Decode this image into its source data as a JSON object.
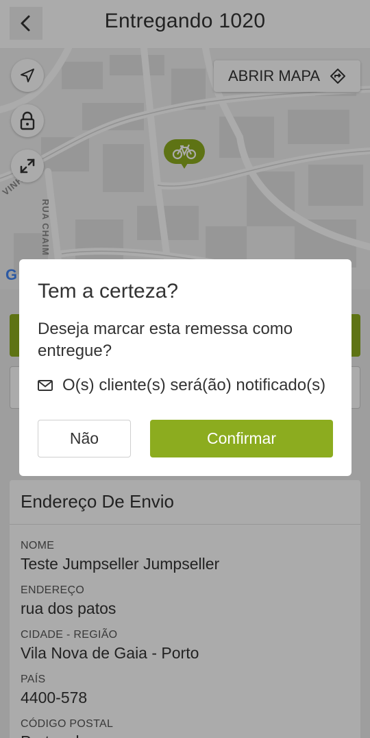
{
  "header": {
    "title": "Entregando 1020",
    "back_icon": "chevron-left-icon"
  },
  "map": {
    "open_map_label": "ABRIR MAPA",
    "open_map_icon": "directions-icon",
    "controls": [
      "navigation-arrow-icon",
      "lock-icon",
      "expand-icon"
    ],
    "marker_icon": "bicycle-icon",
    "street_labels": [
      "RUA CHAIM",
      "VINHA"
    ],
    "attribution": "G",
    "marker_color": "#8cac1f"
  },
  "dialog": {
    "title": "Tem a certeza?",
    "message": "Deseja marcar esta remessa como entregue?",
    "notify_text": "O(s) cliente(s) será(ão) notificado(s)",
    "notify_icon": "envelope-icon",
    "no_label": "Não",
    "confirm_label": "Confirmar",
    "accent_color": "#8cac1f"
  },
  "shipping": {
    "title": "Endereço De Envio",
    "fields": [
      {
        "label": "NOME",
        "value": "Teste Jumpseller Jumpseller"
      },
      {
        "label": "ENDEREÇO",
        "value": "rua dos patos"
      },
      {
        "label": "CIDADE - REGIÃO",
        "value": "Vila Nova de Gaia - Porto"
      },
      {
        "label": "PAÍS",
        "value": "4400-578"
      },
      {
        "label": "CÓDIGO POSTAL",
        "value": "Portugal"
      }
    ]
  }
}
